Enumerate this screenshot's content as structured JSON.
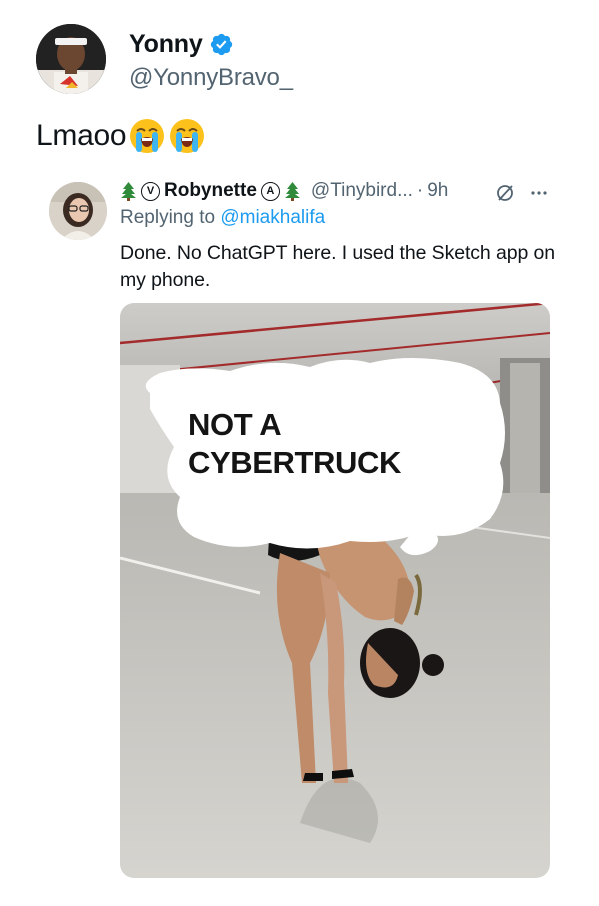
{
  "tweet": {
    "display_name": "Yonny",
    "handle": "@YonnyBravo_",
    "text": "Lmaoo",
    "emoji": [
      "loudly-crying-face",
      "loudly-crying-face"
    ]
  },
  "quote": {
    "badge_left": "V",
    "display_name": "Robynette",
    "badge_right": "A",
    "handle": "@Tinybird...",
    "separator": "·",
    "time": "9h",
    "replying_prefix": "Replying to",
    "replying_to": "@miakhalifa",
    "text": "Done. No ChatGPT here. I used the Sketch app on my phone.",
    "image_caption": "NOT A\nCYBERTRUCK"
  },
  "colors": {
    "link_blue": "#1d9bf0",
    "muted_gray": "#536471",
    "verified_blue": "#1d9bf0"
  }
}
